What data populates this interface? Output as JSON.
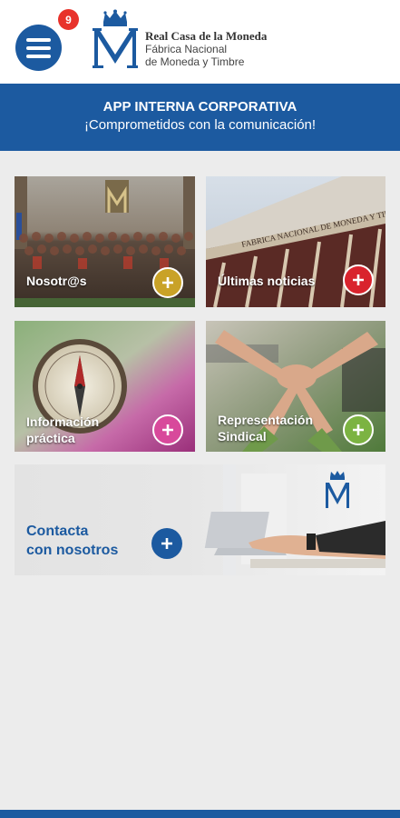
{
  "header": {
    "badge_count": "9",
    "brand_line1": "Real Casa de la Moneda",
    "brand_line2": "Fábrica Nacional",
    "brand_line3": "de Moneda y Timbre"
  },
  "banner": {
    "title": "APP INTERNA CORPORATIVA",
    "subtitle": "¡Comprometidos con la comunicación!"
  },
  "tiles": [
    {
      "label": "Nosotr@s",
      "accent": "#c9a227",
      "icon": "plus-icon"
    },
    {
      "label": "Últimas noticias",
      "accent": "#d9232d",
      "icon": "plus-icon"
    },
    {
      "label_line1": "Información",
      "label_line2": "práctica",
      "accent": "#d8499b",
      "icon": "plus-icon"
    },
    {
      "label_line1": "Representación",
      "label_line2": "Sindical",
      "accent": "#7cb342",
      "icon": "plus-icon"
    }
  ],
  "contact": {
    "label_line1": "Contacta",
    "label_line2": "con nosotros",
    "accent": "#1c5aa0"
  },
  "colors": {
    "brand_blue": "#1c5aa0",
    "badge_red": "#e8322b"
  }
}
